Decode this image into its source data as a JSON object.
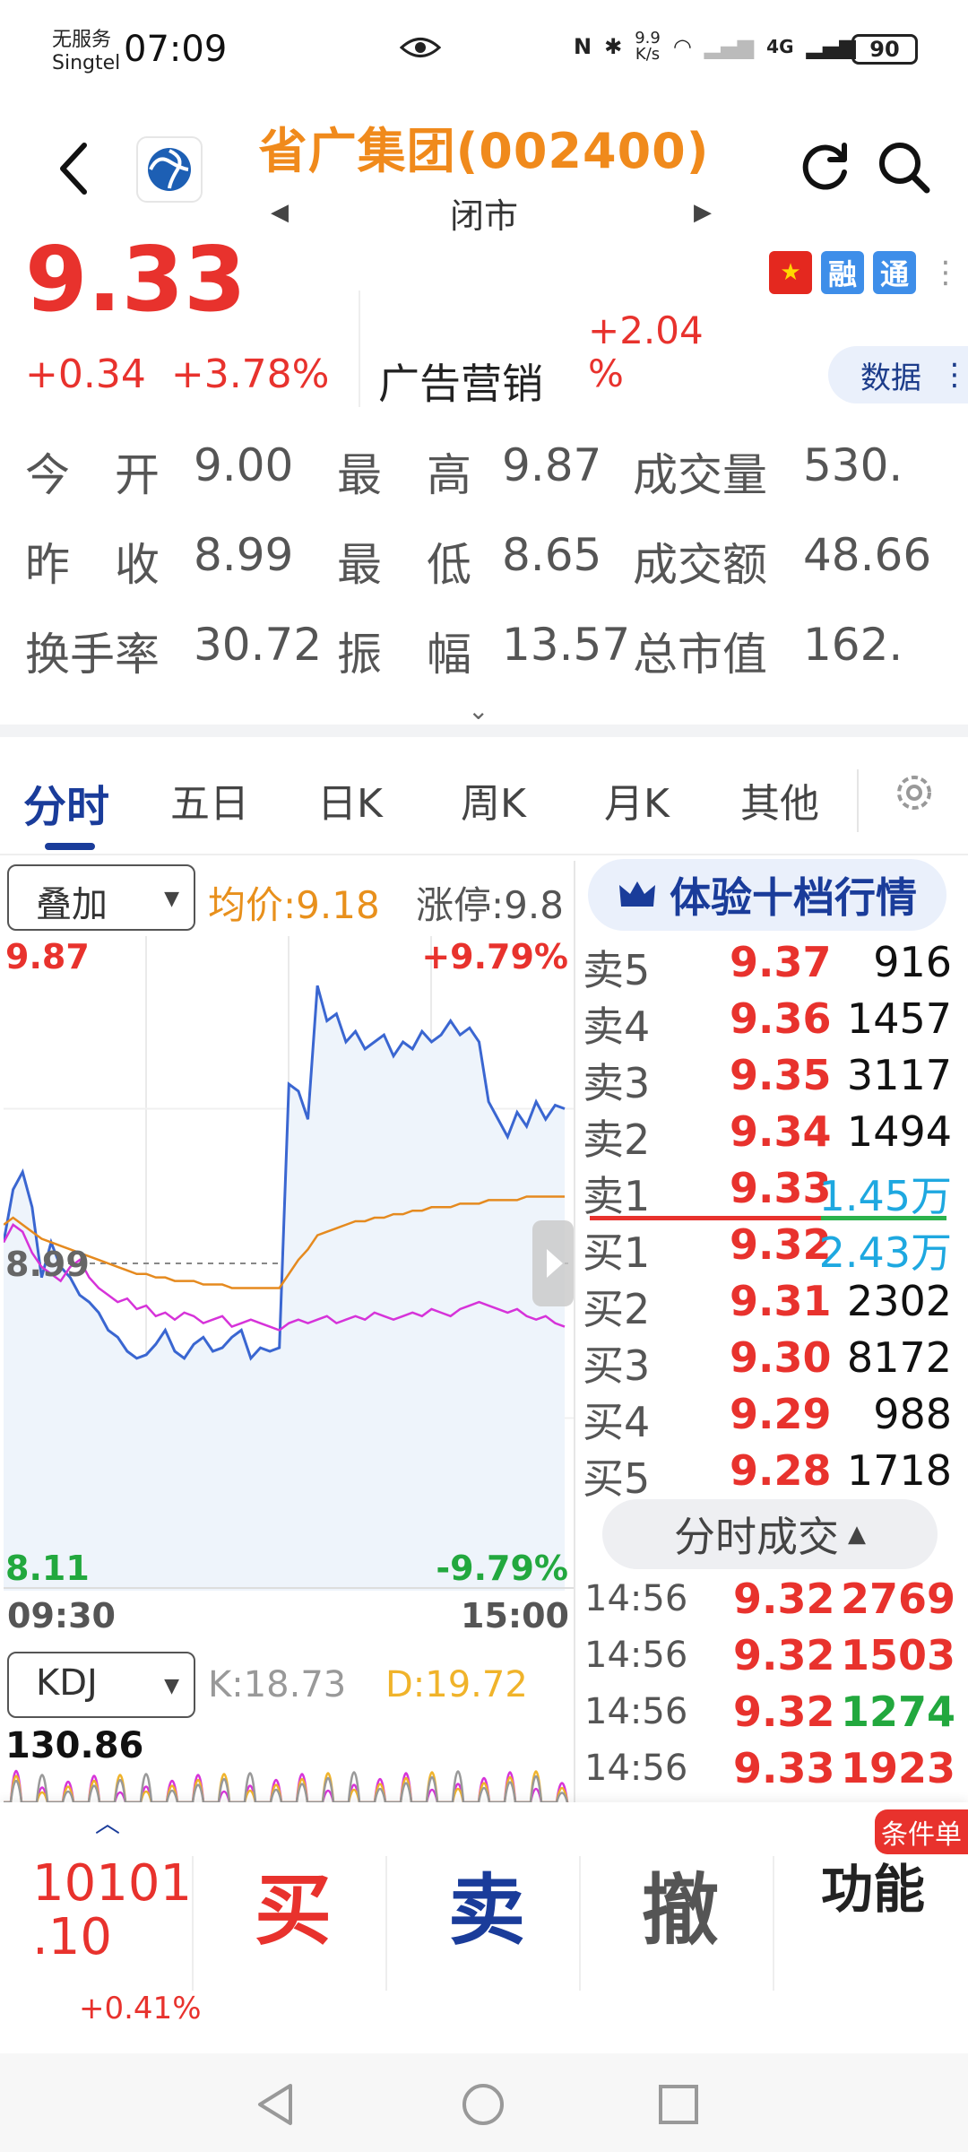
{
  "status_bar": {
    "carrier_line1": "无服务",
    "carrier_line2": "Singtel",
    "time": "07:09",
    "net_speed_top": "9.9",
    "net_speed_bottom": "K/s",
    "network": "4G",
    "battery": "90"
  },
  "header": {
    "title": "省广集团(002400)",
    "market_status": "闭市"
  },
  "price": {
    "last": "9.33",
    "change": "+0.34",
    "change_pct": "+3.78%",
    "sector_name": "广告营销",
    "sector_change_line1": "+2.04",
    "sector_change_line2": "%",
    "badge_rong": "融",
    "badge_tong": "通",
    "flag": "★",
    "data_label": "数据"
  },
  "quote": {
    "rows": [
      [
        {
          "label": "今　开",
          "value": "9.00"
        },
        {
          "label": "最　高",
          "value": "9.87"
        },
        {
          "label": "成交量",
          "value": "530."
        }
      ],
      [
        {
          "label": "昨　收",
          "value": "8.99"
        },
        {
          "label": "最　低",
          "value": "8.65"
        },
        {
          "label": "成交额",
          "value": "48.66"
        }
      ],
      [
        {
          "label": "换手率",
          "value": "30.72"
        },
        {
          "label": "振　幅",
          "value": "13.57"
        },
        {
          "label": "总市值",
          "value": "162."
        }
      ]
    ]
  },
  "tabs": [
    "分时",
    "五日",
    "日K",
    "周K",
    "月K",
    "其他"
  ],
  "chart_header": {
    "overlay_label": "叠加",
    "avg_price": "均价:9.18",
    "limit_up": "涨停:9.8"
  },
  "chart_data": {
    "type": "line",
    "y_high": "9.87",
    "y_mid": "8.99",
    "y_low": "8.11",
    "pct_high": "+9.79%",
    "pct_low": "-9.79%",
    "x_start": "09:30",
    "x_end": "15:00",
    "ylim": [
      8.11,
      9.87
    ],
    "prev_close": 8.99,
    "series": [
      {
        "color": "#3a66d1",
        "values": [
          9.05,
          9.2,
          9.25,
          9.15,
          8.95,
          9.05,
          8.98,
          8.95,
          8.9,
          8.88,
          8.85,
          8.8,
          8.78,
          8.74,
          8.72,
          8.73,
          8.76,
          8.8,
          8.74,
          8.72,
          8.76,
          8.78,
          8.74,
          8.75,
          8.78,
          8.8,
          8.72,
          8.75,
          8.74,
          8.75,
          9.5,
          9.48,
          9.4,
          9.78,
          9.68,
          9.7,
          9.62,
          9.65,
          9.6,
          9.62,
          9.64,
          9.58,
          9.62,
          9.6,
          9.65,
          9.62,
          9.64,
          9.68,
          9.64,
          9.66,
          9.62,
          9.45,
          9.4,
          9.35,
          9.42,
          9.38,
          9.45,
          9.4,
          9.44,
          9.43
        ]
      },
      {
        "color": "#e58a1f",
        "values": [
          9.1,
          9.12,
          9.1,
          9.08,
          9.06,
          9.05,
          9.04,
          9.03,
          9.02,
          9.01,
          9.0,
          8.99,
          8.98,
          8.97,
          8.96,
          8.96,
          8.95,
          8.95,
          8.94,
          8.94,
          8.94,
          8.93,
          8.93,
          8.93,
          8.92,
          8.92,
          8.92,
          8.92,
          8.92,
          8.92,
          8.96,
          9.0,
          9.03,
          9.07,
          9.08,
          9.09,
          9.1,
          9.11,
          9.11,
          9.12,
          9.12,
          9.13,
          9.13,
          9.14,
          9.14,
          9.15,
          9.15,
          9.15,
          9.16,
          9.16,
          9.16,
          9.17,
          9.17,
          9.17,
          9.17,
          9.18,
          9.18,
          9.18,
          9.18,
          9.18
        ]
      },
      {
        "color": "#d633d9",
        "values": [
          9.05,
          9.1,
          9.08,
          9.02,
          8.98,
          8.96,
          8.94,
          8.98,
          9.0,
          8.95,
          8.92,
          8.9,
          8.88,
          8.89,
          8.86,
          8.87,
          8.84,
          8.85,
          8.83,
          8.85,
          8.84,
          8.82,
          8.83,
          8.84,
          8.81,
          8.82,
          8.83,
          8.82,
          8.81,
          8.8,
          8.82,
          8.83,
          8.82,
          8.83,
          8.84,
          8.82,
          8.83,
          8.84,
          8.83,
          8.85,
          8.84,
          8.83,
          8.84,
          8.85,
          8.84,
          8.86,
          8.85,
          8.84,
          8.86,
          8.87,
          8.88,
          8.87,
          8.86,
          8.85,
          8.86,
          8.84,
          8.83,
          8.84,
          8.82,
          8.81
        ]
      }
    ]
  },
  "kdj": {
    "selector_label": "KDJ",
    "k": "K:18.73",
    "d": "D:19.72",
    "max": "130.86"
  },
  "order_book": {
    "button_label": "体验十档行情",
    "asks": [
      {
        "label": "卖5",
        "price": "9.37",
        "vol": "916",
        "blue": false
      },
      {
        "label": "卖4",
        "price": "9.36",
        "vol": "1457",
        "blue": false
      },
      {
        "label": "卖3",
        "price": "9.35",
        "vol": "3117",
        "blue": false
      },
      {
        "label": "卖2",
        "price": "9.34",
        "vol": "1494",
        "blue": false
      },
      {
        "label": "卖1",
        "price": "9.33",
        "vol": "1.45万",
        "blue": true
      }
    ],
    "bids": [
      {
        "label": "买1",
        "price": "9.32",
        "vol": "2.43万",
        "blue": true
      },
      {
        "label": "买2",
        "price": "9.31",
        "vol": "2302",
        "blue": false
      },
      {
        "label": "买3",
        "price": "9.30",
        "vol": "8172",
        "blue": false
      },
      {
        "label": "买4",
        "price": "9.29",
        "vol": "988",
        "blue": false
      },
      {
        "label": "买5",
        "price": "9.28",
        "vol": "1718",
        "blue": false
      }
    ]
  },
  "time_sales": {
    "button_label": "分时成交",
    "rows": [
      {
        "time": "14:56",
        "price": "9.32",
        "vol": "2769",
        "color": "#e8322d"
      },
      {
        "time": "14:56",
        "price": "9.32",
        "vol": "1503",
        "color": "#e8322d"
      },
      {
        "time": "14:56",
        "price": "9.32",
        "vol": "1274",
        "color": "#22a83e"
      },
      {
        "time": "14:56",
        "price": "9.33",
        "vol": "1923",
        "color": "#e8322d"
      }
    ]
  },
  "trade_bar": {
    "index_line1": "10101",
    "index_line2": ".10",
    "index_change": "+0.41%",
    "buy": "买",
    "sell": "卖",
    "cancel": "撤",
    "function": "功能",
    "condition_badge": "条件单"
  }
}
